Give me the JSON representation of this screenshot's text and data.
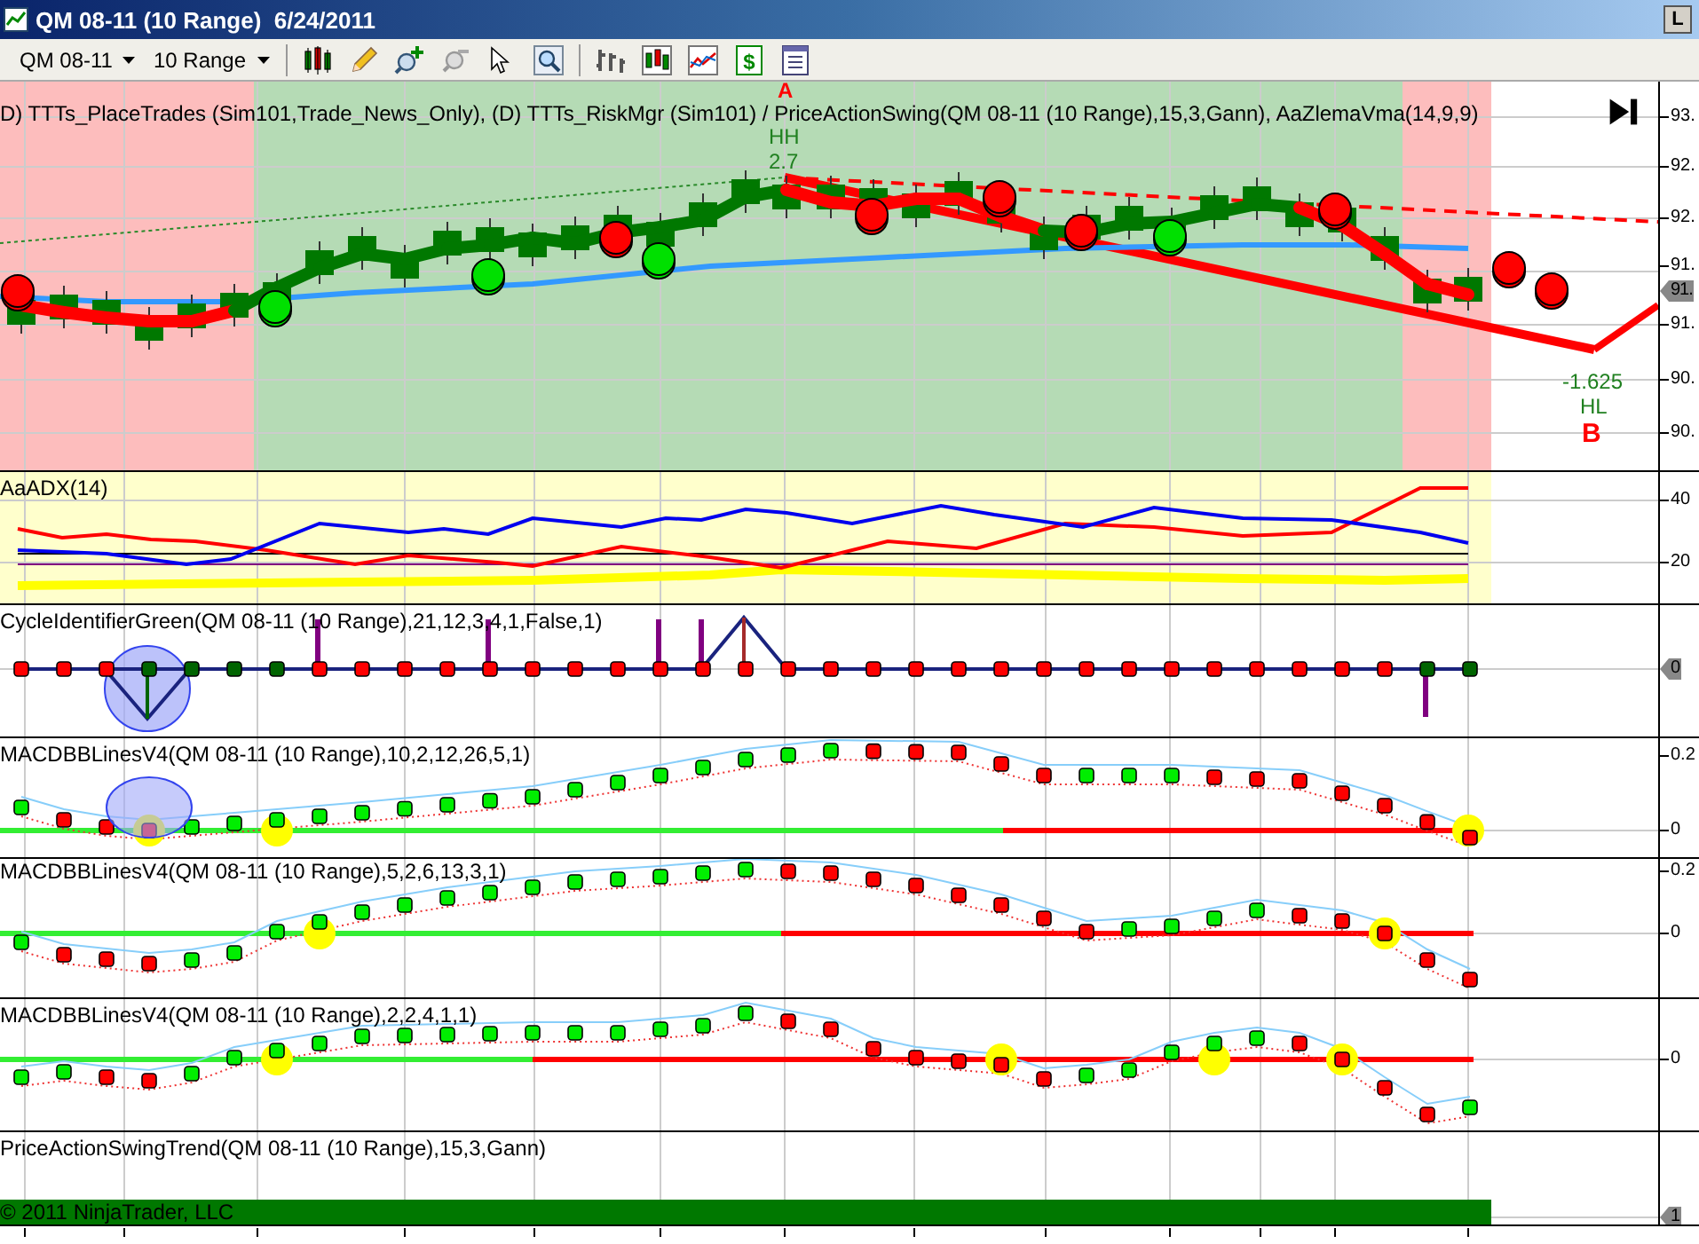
{
  "window": {
    "title": "QM 08-11 (10 Range)  6/24/2011",
    "corner_button": "L"
  },
  "toolbar": {
    "instrument": "QM 08-11",
    "interval": "10 Range",
    "dollar_icon_glyph": "$"
  },
  "panels": [
    {
      "kind": "price",
      "label": "D) TTTs_PlaceTrades (Sim101,Trade_News_Only), (D) TTTs_RiskMgr (Sim101) / PriceActionSwing(QM 08-11 (10 Range),15,3,Gann), AaZlemaVma(14,9,9)",
      "axis_labels": [
        "93.",
        "92.",
        "92.",
        "91.",
        "91.",
        "90.",
        "90."
      ],
      "marker": "91.",
      "swing_labels": [
        {
          "kind": "point",
          "text": "A"
        },
        {
          "kind": "type",
          "text": "HH"
        },
        {
          "kind": "value",
          "text": "2.7"
        },
        {
          "kind": "value",
          "text": "-1.625"
        },
        {
          "kind": "type",
          "text": "HL"
        },
        {
          "kind": "point",
          "text": "B"
        }
      ]
    },
    {
      "kind": "adx",
      "label": "AaADX(14)",
      "axis_labels": [
        "40",
        "20"
      ]
    },
    {
      "kind": "cycle",
      "label": "CycleIdentifierGreen(QM 08-11 (10 Range),21,12,3,4,1,False,1)",
      "marker": "0"
    },
    {
      "kind": "macd1",
      "label": "MACDBBLinesV4(QM 08-11 (10 Range),10,2,12,26,5,1)",
      "axis_labels": [
        "0.2",
        "0"
      ]
    },
    {
      "kind": "macd2",
      "label": "MACDBBLinesV4(QM 08-11 (10 Range),5,2,6,13,3,1)",
      "axis_labels": [
        "0.2",
        "0"
      ]
    },
    {
      "kind": "macd3",
      "label": "MACDBBLinesV4(QM 08-11 (10 Range),2,2,4,1,1)",
      "axis_labels": [
        "0"
      ]
    },
    {
      "kind": "trend",
      "label": "PriceActionSwingTrend(QM 08-11 (10 Range),15,3,Gann)",
      "marker": "1",
      "copyright": "© 2011 NinjaTrader, LLC"
    }
  ]
}
